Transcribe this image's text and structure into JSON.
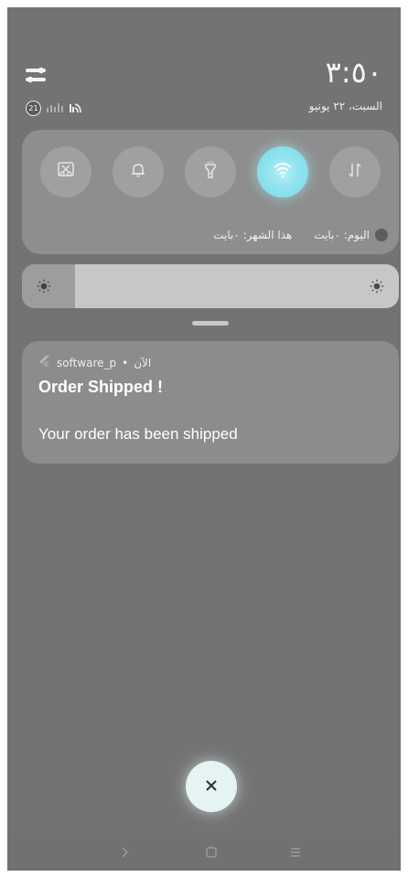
{
  "status_bar": {
    "time": "٣:٥٠",
    "date": "السبت، ٢٢ يونيو",
    "notification_count": "21"
  },
  "quick_settings": {
    "tiles": [
      {
        "name": "screenshot",
        "active": false
      },
      {
        "name": "sound",
        "active": false
      },
      {
        "name": "flashlight",
        "active": false
      },
      {
        "name": "wifi",
        "active": true
      },
      {
        "name": "mobile-data",
        "active": false
      }
    ],
    "data_usage_today": "اليوم: ٠بايت",
    "data_usage_month": "هذا الشهر: ٠بايت"
  },
  "brightness": {
    "level": 0.14
  },
  "notification": {
    "app_name": "software_p",
    "time": "الآن",
    "separator": "•",
    "title": "Order Shipped !",
    "body": "Your order has been shipped"
  },
  "colors": {
    "background": "#737373",
    "panel": "#8e8e8e",
    "accent": "#8ee3ef"
  }
}
